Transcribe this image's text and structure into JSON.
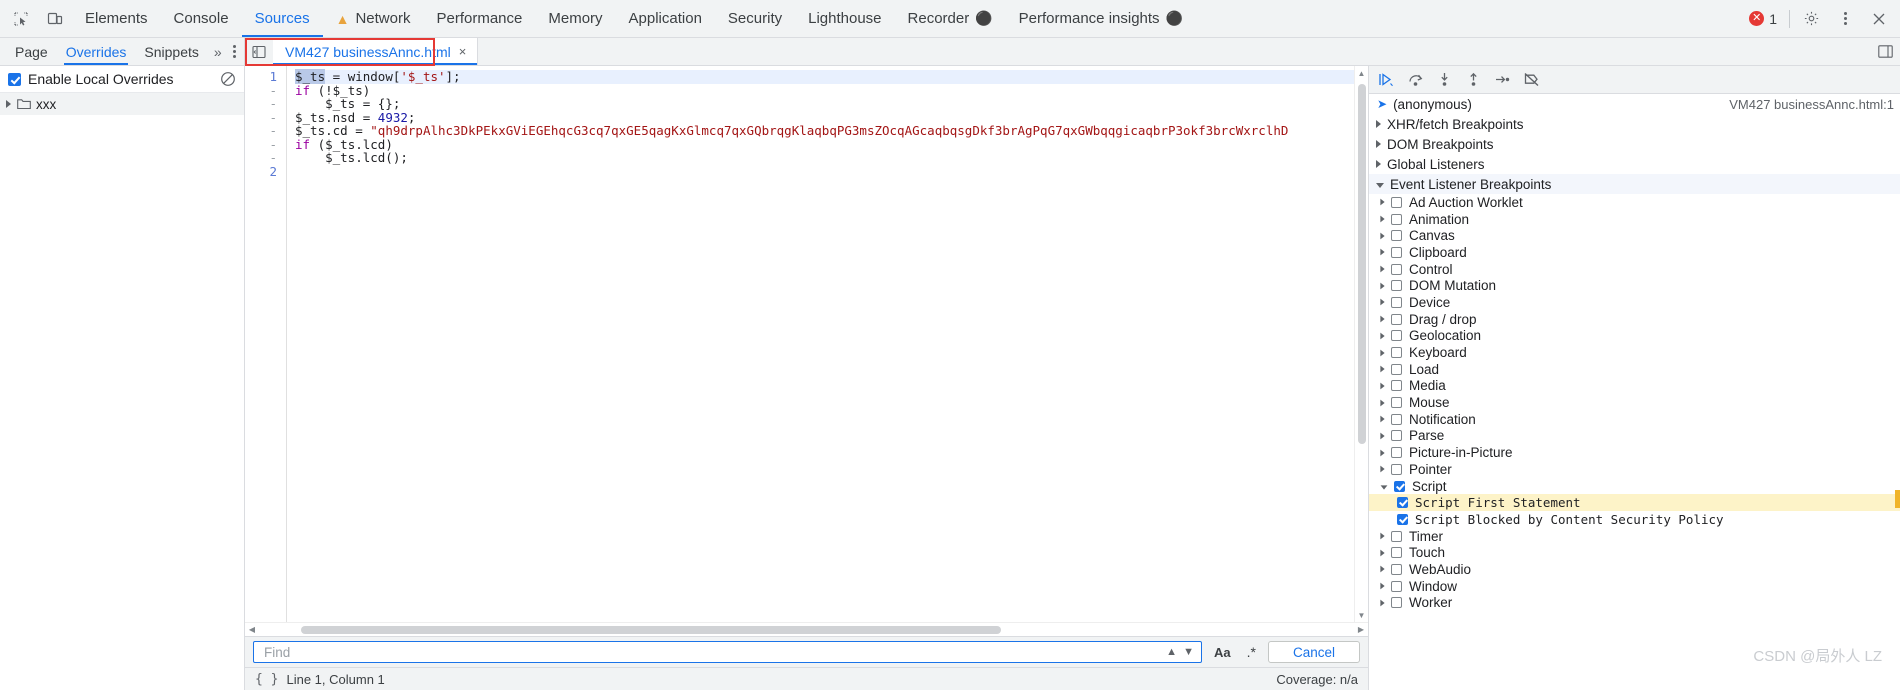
{
  "main_tabs": [
    {
      "label": "Elements",
      "active": false,
      "icon": null
    },
    {
      "label": "Console",
      "active": false,
      "icon": null
    },
    {
      "label": "Sources",
      "active": true,
      "icon": null
    },
    {
      "label": "Network",
      "active": false,
      "icon": "warning-triangle-icon"
    },
    {
      "label": "Performance",
      "active": false,
      "icon": null
    },
    {
      "label": "Memory",
      "active": false,
      "icon": null
    },
    {
      "label": "Application",
      "active": false,
      "icon": null
    },
    {
      "label": "Security",
      "active": false,
      "icon": null
    },
    {
      "label": "Lighthouse",
      "active": false,
      "icon": null
    },
    {
      "label": "Recorder",
      "active": false,
      "icon": "flask-icon"
    },
    {
      "label": "Performance insights",
      "active": false,
      "icon": "flask-icon"
    }
  ],
  "toolbar": {
    "inspect_icon": "inspect-element-icon",
    "device_icon": "device-toolbar-icon",
    "error_count": "1",
    "settings_icon": "gear-icon",
    "more_icon": "kebab-menu-icon",
    "close_icon": "close-icon"
  },
  "navigator": {
    "subtabs": [
      {
        "label": "Page",
        "active": false
      },
      {
        "label": "Overrides",
        "active": true
      },
      {
        "label": "Snippets",
        "active": false
      }
    ],
    "more_label": "»",
    "enable_overrides_label": "Enable Local Overrides",
    "enable_overrides_checked": true,
    "clear_icon": "clear-overrides-icon",
    "folder": {
      "label": "xxx",
      "icon": "folder-icon"
    }
  },
  "file_tabs": [
    {
      "label": "VM427 businessAnnc.html",
      "active": true,
      "close": "×"
    }
  ],
  "file_tab_panel_icon": "navigator-toggle-icon",
  "dock_icon": "dock-side-icon",
  "editor": {
    "gutter": [
      "1",
      "-",
      "-",
      "-",
      "-",
      "-",
      "-",
      "2"
    ],
    "lines": [
      {
        "current": true,
        "tokens": [
          {
            "t": "$_ts",
            "c": "sel"
          },
          {
            "t": " = ",
            "c": "plain"
          },
          {
            "t": "window",
            "c": "plain"
          },
          {
            "t": "[",
            "c": "plain"
          },
          {
            "t": "'$_ts'",
            "c": "str"
          },
          {
            "t": "];",
            "c": "plain"
          }
        ]
      },
      {
        "current": false,
        "tokens": [
          {
            "t": "if",
            "c": "kw2"
          },
          {
            "t": " (!$_ts)",
            "c": "plain"
          }
        ]
      },
      {
        "current": false,
        "tokens": [
          {
            "t": "    $_ts = {};",
            "c": "plain"
          }
        ]
      },
      {
        "current": false,
        "tokens": [
          {
            "t": "$_ts.nsd = ",
            "c": "plain"
          },
          {
            "t": "4932",
            "c": "num"
          },
          {
            "t": ";",
            "c": "plain"
          }
        ]
      },
      {
        "current": false,
        "tokens": [
          {
            "t": "$_ts.cd = ",
            "c": "plain"
          },
          {
            "t": "\"qh9drpAlhc3DkPEkxGViEGEhqcG3cq7qxGE5qagKxGlmcq7qxGQbrqgKlaqbqPG3msZOcqAGcaqbqsgDkf3brAgPqG7qxGWbqqgicaqbrP3okf3brcWxrclhD",
            "c": "str"
          }
        ]
      },
      {
        "current": false,
        "tokens": [
          {
            "t": "if",
            "c": "kw2"
          },
          {
            "t": " ($_ts.lcd)",
            "c": "plain"
          }
        ]
      },
      {
        "current": false,
        "tokens": [
          {
            "t": "    $_ts.lcd();",
            "c": "plain"
          }
        ]
      }
    ]
  },
  "find_bar": {
    "placeholder": "Find",
    "value": "",
    "prev_icon": "chevron-up-icon",
    "next_icon": "chevron-down-icon",
    "match_case_label": "Aa",
    "regex_label": ".*",
    "cancel_label": "Cancel"
  },
  "status_bar": {
    "format_icon": "pretty-print-icon",
    "position": "Line 1, Column 1",
    "coverage": "Coverage: n/a"
  },
  "debugger": {
    "toolbar_buttons": [
      {
        "name": "resume-script-execution-icon",
        "primary": true
      },
      {
        "name": "step-over-next-function-call-icon",
        "primary": false
      },
      {
        "name": "step-into-next-function-call-icon",
        "primary": false
      },
      {
        "name": "step-out-of-current-function-icon",
        "primary": false
      },
      {
        "name": "step-icon",
        "primary": false
      },
      {
        "name": "deactivate-breakpoints-icon",
        "primary": false
      }
    ],
    "call_stack": {
      "function": "(anonymous)",
      "location": "VM427 businessAnnc.html:1"
    },
    "sections": [
      {
        "label": "XHR/fetch Breakpoints",
        "expanded": false
      },
      {
        "label": "DOM Breakpoints",
        "expanded": false
      },
      {
        "label": "Global Listeners",
        "expanded": false
      },
      {
        "label": "Event Listener Breakpoints",
        "expanded": true
      }
    ],
    "event_listener_breakpoints": [
      {
        "label": "Ad Auction Worklet",
        "checked": false,
        "expanded": false
      },
      {
        "label": "Animation",
        "checked": false,
        "expanded": false
      },
      {
        "label": "Canvas",
        "checked": false,
        "expanded": false
      },
      {
        "label": "Clipboard",
        "checked": false,
        "expanded": false
      },
      {
        "label": "Control",
        "checked": false,
        "expanded": false
      },
      {
        "label": "DOM Mutation",
        "checked": false,
        "expanded": false
      },
      {
        "label": "Device",
        "checked": false,
        "expanded": false
      },
      {
        "label": "Drag / drop",
        "checked": false,
        "expanded": false
      },
      {
        "label": "Geolocation",
        "checked": false,
        "expanded": false
      },
      {
        "label": "Keyboard",
        "checked": false,
        "expanded": false
      },
      {
        "label": "Load",
        "checked": false,
        "expanded": false
      },
      {
        "label": "Media",
        "checked": false,
        "expanded": false
      },
      {
        "label": "Mouse",
        "checked": false,
        "expanded": false
      },
      {
        "label": "Notification",
        "checked": false,
        "expanded": false
      },
      {
        "label": "Parse",
        "checked": false,
        "expanded": false
      },
      {
        "label": "Picture-in-Picture",
        "checked": false,
        "expanded": false
      },
      {
        "label": "Pointer",
        "checked": false,
        "expanded": false
      },
      {
        "label": "Script",
        "checked": true,
        "expanded": true,
        "children": [
          {
            "label": "Script First Statement",
            "checked": true,
            "highlighted": true
          },
          {
            "label": "Script Blocked by Content Security Policy",
            "checked": true,
            "highlighted": false
          }
        ]
      },
      {
        "label": "Timer",
        "checked": false,
        "expanded": false
      },
      {
        "label": "Touch",
        "checked": false,
        "expanded": false
      },
      {
        "label": "WebAudio",
        "checked": false,
        "expanded": false
      },
      {
        "label": "Window",
        "checked": false,
        "expanded": false
      },
      {
        "label": "Worker",
        "checked": false,
        "expanded": false
      }
    ]
  },
  "watermark": "CSDN @局外人 LZ",
  "colors": {
    "accent": "#1a73e8",
    "toolbar_bg": "#f1f3f4",
    "error_red": "#e53935",
    "highlight_yellow": "#fdf3c8",
    "string_red": "#a31515"
  }
}
